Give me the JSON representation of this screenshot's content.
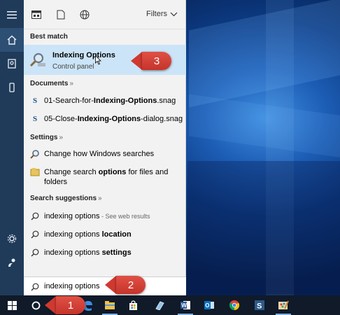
{
  "panel": {
    "filters_label": "Filters",
    "best_match_heading": "Best match",
    "best_match": {
      "title": "Indexing Options",
      "subtitle": "Control panel"
    },
    "documents_heading": "Documents",
    "documents": [
      {
        "prefix": "01-Search-for-",
        "bold": "Indexing-Options",
        "suffix": ".snag"
      },
      {
        "prefix": "05-Close-",
        "bold": "Indexing-Options",
        "suffix": "-dialog.snag"
      }
    ],
    "settings_heading": "Settings",
    "settings": [
      {
        "text": "Change how Windows searches"
      },
      {
        "prefix": "Change search ",
        "bold": "options",
        "suffix": " for files and",
        "line2": "folders"
      }
    ],
    "suggestions_heading": "Search suggestions",
    "suggestions": [
      {
        "text": "indexing options",
        "extra": " - See web results",
        "bold": ""
      },
      {
        "text": "indexing options ",
        "extra": "",
        "bold": "location"
      },
      {
        "text": "indexing options ",
        "extra": "",
        "bold": "settings"
      }
    ],
    "search_value": "indexing options",
    "section_arrow": "»"
  },
  "callouts": {
    "one": "1",
    "two": "2",
    "three": "3"
  },
  "icons": {
    "rail": [
      "hamburger-icon",
      "home-icon",
      "notebook-icon",
      "device-icon",
      "settings-icon",
      "feedback-icon"
    ],
    "taskbar": [
      "windows-start-icon",
      "cortana-icon",
      "edge-icon",
      "file-explorer-icon",
      "store-icon",
      "tablet-icon",
      "word-icon",
      "outlook-icon",
      "chrome-icon",
      "snagit-icon",
      "paint-icon"
    ]
  },
  "colors": {
    "rail": "#1f3b59",
    "panel": "#f2f2f2",
    "highlight": "#cce4f7",
    "taskbar": "#101a29",
    "callout": "#d63e33"
  }
}
